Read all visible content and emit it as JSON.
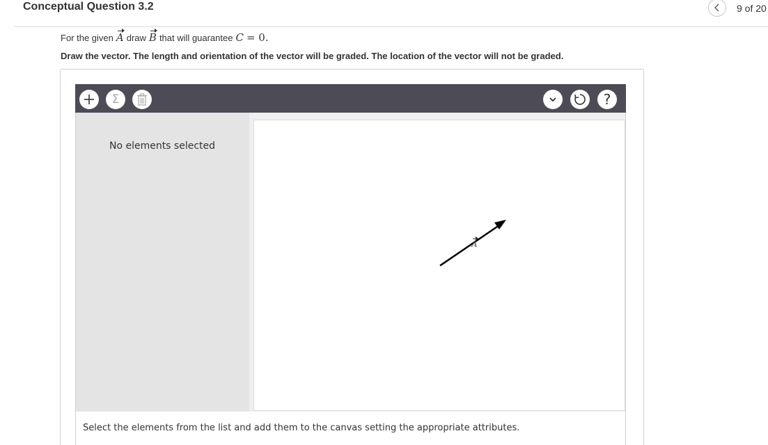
{
  "header": {
    "title": "Conceptual Question 3.2",
    "counter": "9 of 20"
  },
  "question": {
    "prompt_prefix": "For the given",
    "vector_a": "A",
    "prompt_middle": "draw",
    "vector_b": "B",
    "prompt_suffix": "that will guarantee",
    "result_symbol": "C",
    "result_equals": "= 0.",
    "instruction": "Draw the vector. The length and orientation of the vector will be graded. The location of the vector will not be graded."
  },
  "toolbar": {
    "left_icons": [
      "plus-icon",
      "sigma-icon",
      "trash-icon"
    ],
    "right_icons": [
      "chevron-down-icon",
      "reset-icon",
      "help-icon"
    ],
    "help_glyph": "?",
    "sigma_glyph": "Σ",
    "background": "#4c4b56"
  },
  "side_panel": {
    "message": "No elements selected"
  },
  "canvas": {
    "vector_label": "A"
  },
  "footer": {
    "instructions": "Select the elements from the list and add them to the canvas setting the appropriate attributes."
  }
}
